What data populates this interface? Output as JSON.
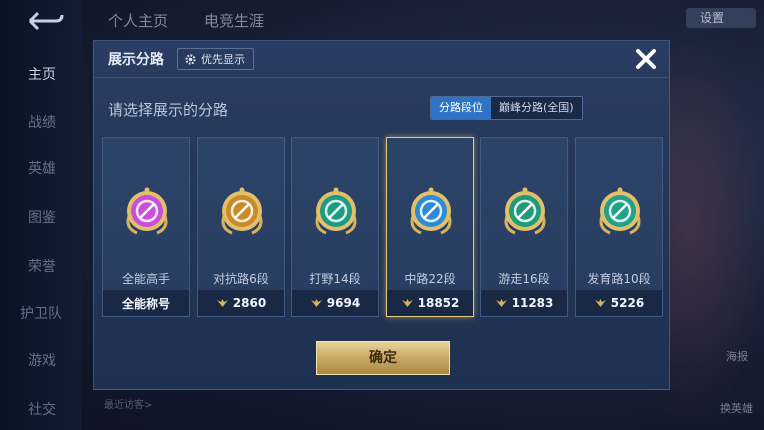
{
  "background": {
    "top_tabs": [
      "个人主页",
      "电竞生涯"
    ],
    "sidebar": [
      "主页",
      "战绩",
      "英雄",
      "图鉴",
      "荣誉",
      "护卫队",
      "游戏",
      "社交"
    ],
    "settings_label": "设置",
    "recent_visitors_label": "最近访客>",
    "right_labels": [
      "海报",
      "换英雄"
    ]
  },
  "dialog": {
    "title": "展示分路",
    "priority_button": "优先显示",
    "subtitle": "请选择展示的分路",
    "toggle": {
      "active": "分路段位",
      "inactive": "巅峰分路(全国)"
    },
    "cards": [
      {
        "name": "全能高手",
        "footer": "全能称号",
        "badge_icon": "all-round-badge-icon",
        "badge_color": "#c84fd6",
        "selected": false
      },
      {
        "name": "对抗路6段",
        "footer": "2860",
        "badge_icon": "clash-lane-badge-icon",
        "badge_color": "#c98a2a",
        "selected": false
      },
      {
        "name": "打野14段",
        "footer": "9694",
        "badge_icon": "jungle-badge-icon",
        "badge_color": "#1f9b84",
        "selected": false
      },
      {
        "name": "中路22段",
        "footer": "18852",
        "badge_icon": "mid-lane-badge-icon",
        "badge_color": "#2d8ad6",
        "selected": true
      },
      {
        "name": "游走16段",
        "footer": "11283",
        "badge_icon": "roam-badge-icon",
        "badge_color": "#1f9b7a",
        "selected": false
      },
      {
        "name": "发育路10段",
        "footer": "5226",
        "badge_icon": "farm-lane-badge-icon",
        "badge_color": "#21a08a",
        "selected": false
      }
    ],
    "confirm": "确定"
  },
  "colors": {
    "accent_gold": "#e7c878",
    "toggle_active": "#2e74c6"
  }
}
